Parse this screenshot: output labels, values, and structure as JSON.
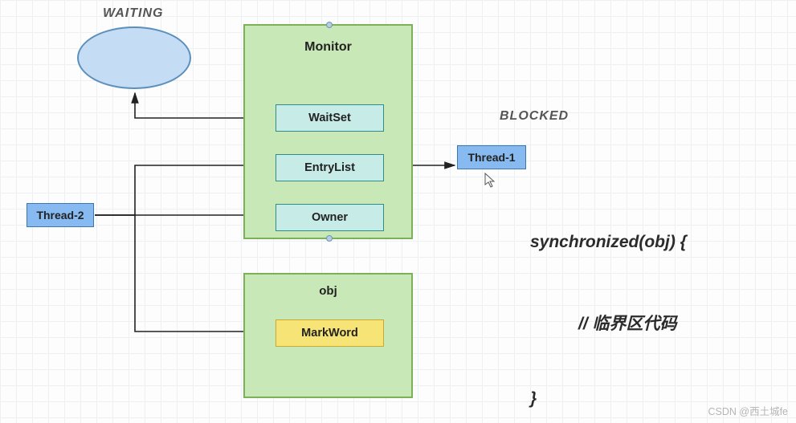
{
  "labels": {
    "waiting": "WAITING",
    "blocked": "BLOCKED"
  },
  "monitor": {
    "title": "Monitor",
    "waitset": "WaitSet",
    "entrylist": "EntryList",
    "owner": "Owner"
  },
  "threads": {
    "t1": "Thread-1",
    "t2": "Thread-2"
  },
  "obj": {
    "title": "obj",
    "markword": "MarkWord"
  },
  "code": {
    "sync": "synchronized(obj) {",
    "crit": "// 临界区代码",
    "close": "}"
  },
  "watermark": "CSDN @西土城fe"
}
